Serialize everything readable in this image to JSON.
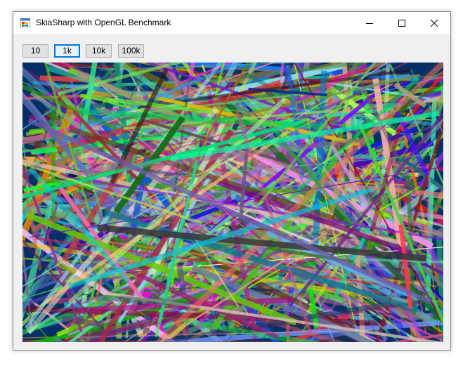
{
  "window": {
    "title": "SkiaSharp with OpenGL Benchmark"
  },
  "toolbar": {
    "buttons": [
      {
        "label": "10",
        "active": false
      },
      {
        "label": "1k",
        "active": true
      },
      {
        "label": "10k",
        "active": false
      },
      {
        "label": "100k",
        "active": false
      }
    ]
  },
  "canvas": {
    "background": "#062f63",
    "line_count_selected": "1k"
  },
  "colors": {
    "accent": "#0078d7",
    "canvas_bg": "#062f63"
  }
}
